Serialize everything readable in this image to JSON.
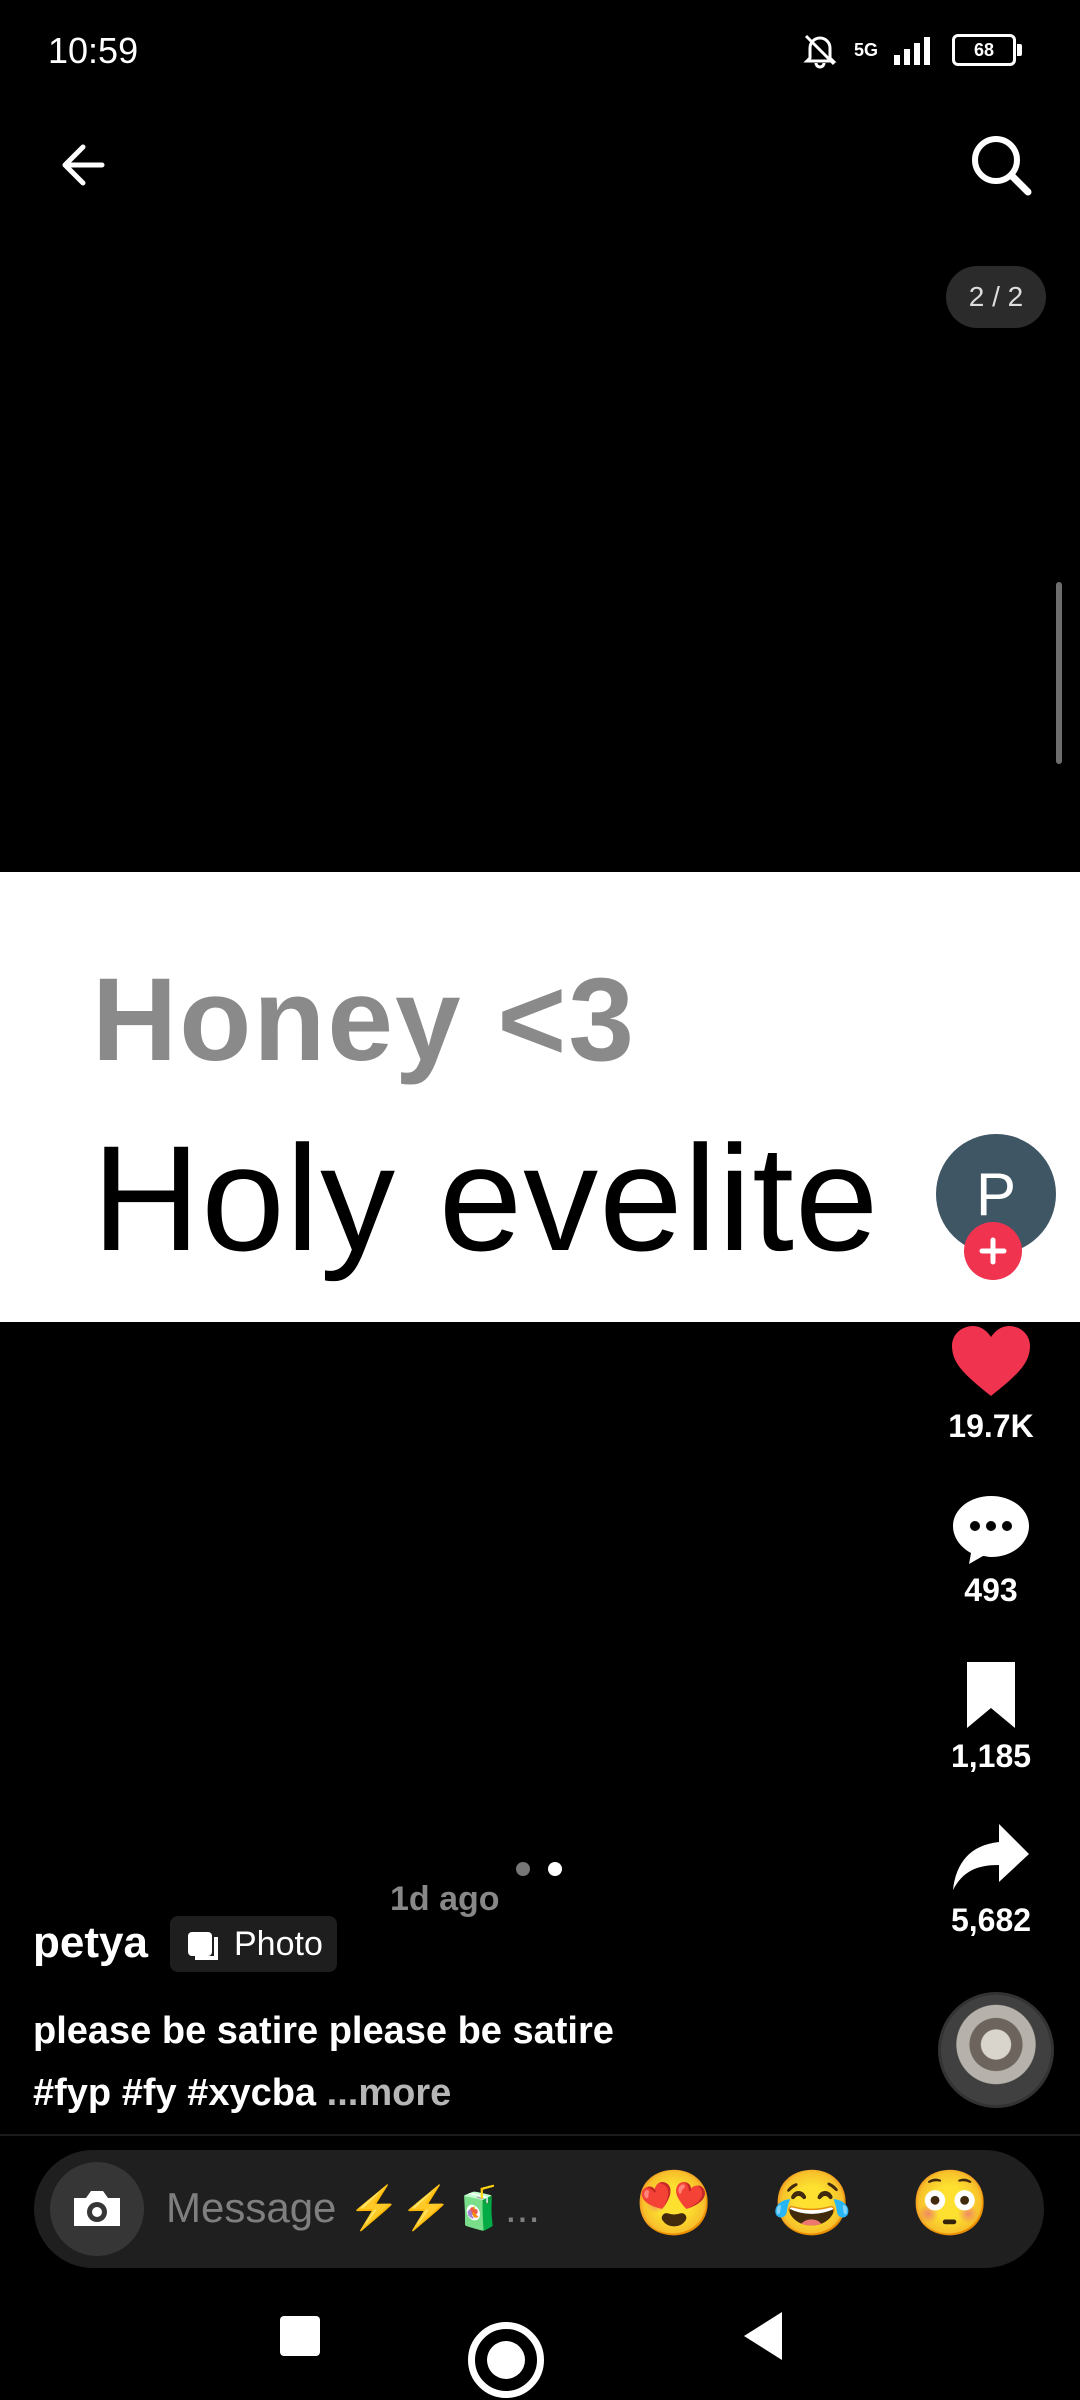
{
  "status_bar": {
    "time": "10:59",
    "network": "5G",
    "battery": "68"
  },
  "viewer": {
    "page_indicator": "2 / 2",
    "headline": "Honey <3",
    "subline": "Holy evelite",
    "ghost_text": "1d ago"
  },
  "creator": {
    "avatar_letter": "P",
    "username": "petya",
    "badge": "Photo"
  },
  "engagement": {
    "likes": "19.7K",
    "comments": "493",
    "saves": "1,185",
    "shares": "5,682"
  },
  "caption": {
    "text": "please be satire please be satire",
    "tags": [
      "#fyp",
      "#fy",
      "#xycba"
    ],
    "more": "...more"
  },
  "message": {
    "placeholder": "Message ⚡⚡🧃...",
    "emojis": [
      "😍",
      "😂",
      "😳"
    ]
  },
  "colors": {
    "accent": "#f0334f"
  }
}
